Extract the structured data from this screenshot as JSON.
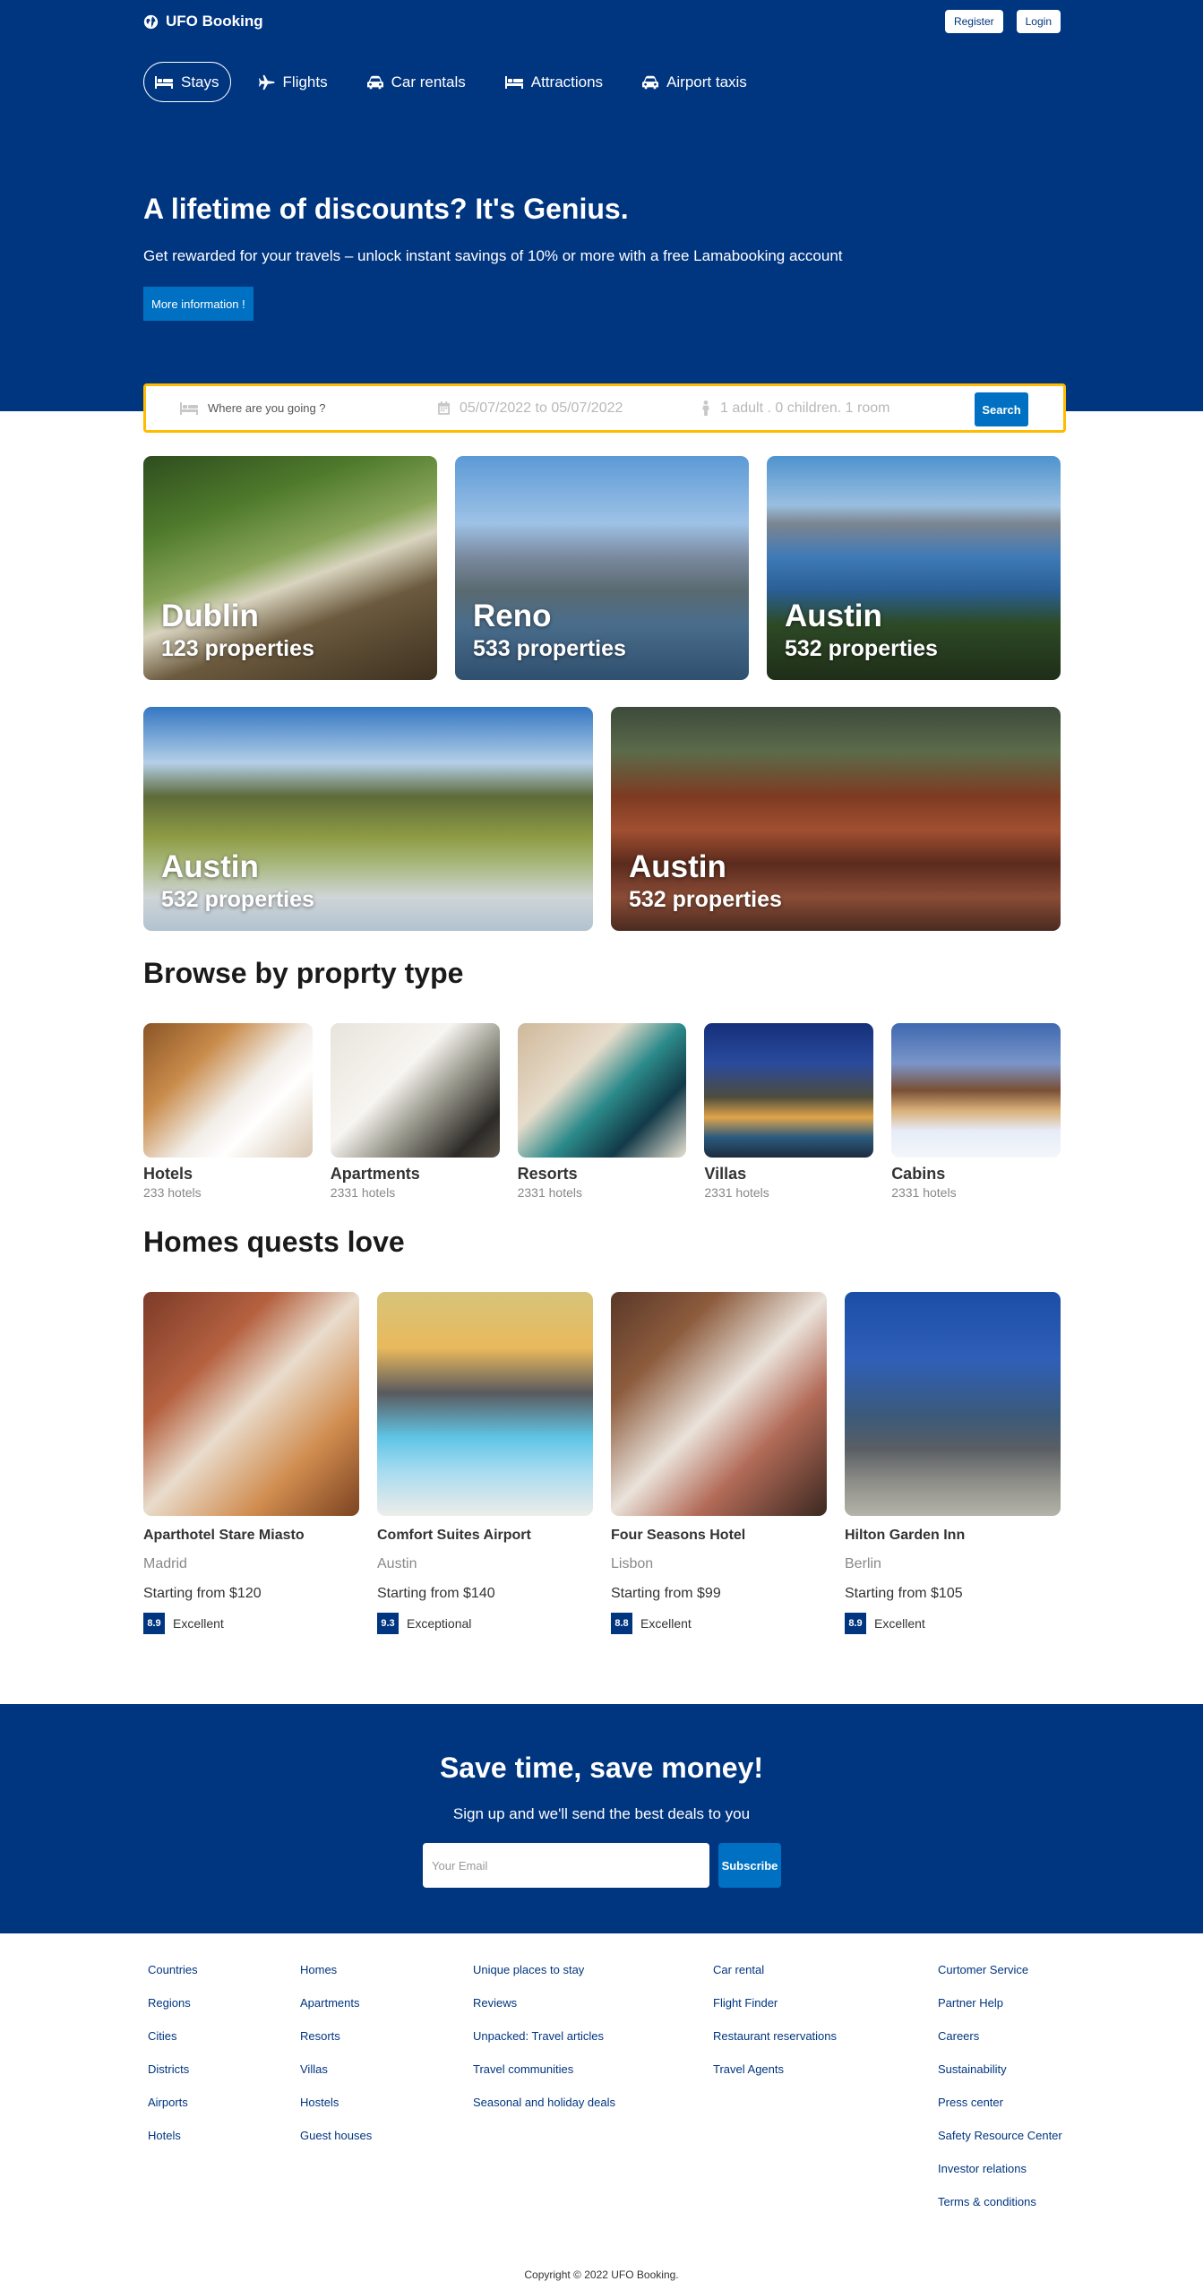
{
  "header": {
    "logo": "UFO Booking",
    "register": "Register",
    "login": "Login",
    "nav": [
      {
        "label": "Stays",
        "icon": "bed-icon",
        "active": true
      },
      {
        "label": "Flights",
        "icon": "plane-icon",
        "active": false
      },
      {
        "label": "Car rentals",
        "icon": "car-icon",
        "active": false
      },
      {
        "label": "Attractions",
        "icon": "bed-icon",
        "active": false
      },
      {
        "label": "Airport taxis",
        "icon": "taxi-icon",
        "active": false
      }
    ],
    "title": "A lifetime of discounts? It's Genius.",
    "desc": "Get rewarded for your travels – unlock instant savings of 10% or more with a free Lamabooking account",
    "cta": "More information !"
  },
  "search": {
    "destination_placeholder": "Where are you going ?",
    "dates": "05/07/2022 to 05/07/2022",
    "guests": "1 adult . 0 children. 1 room",
    "button": "Search"
  },
  "featured": [
    {
      "name": "Dublin",
      "count": "123 properties"
    },
    {
      "name": "Reno",
      "count": "533 properties"
    },
    {
      "name": "Austin",
      "count": "532 properties"
    },
    {
      "name": "Austin",
      "count": "532 properties"
    },
    {
      "name": "Austin",
      "count": "532 properties"
    }
  ],
  "property_types": {
    "title": "Browse by proprty type",
    "items": [
      {
        "name": "Hotels",
        "count": "233 hotels"
      },
      {
        "name": "Apartments",
        "count": "2331 hotels"
      },
      {
        "name": "Resorts",
        "count": "2331 hotels"
      },
      {
        "name": "Villas",
        "count": "2331 hotels"
      },
      {
        "name": "Cabins",
        "count": "2331 hotels"
      }
    ]
  },
  "homes": {
    "title": "Homes quests love",
    "items": [
      {
        "name": "Aparthotel Stare Miasto",
        "city": "Madrid",
        "price": "Starting from $120",
        "score": "8.9",
        "rating": "Excellent"
      },
      {
        "name": "Comfort Suites Airport",
        "city": "Austin",
        "price": "Starting from $140",
        "score": "9.3",
        "rating": "Exceptional"
      },
      {
        "name": "Four Seasons Hotel",
        "city": "Lisbon",
        "price": "Starting from $99",
        "score": "8.8",
        "rating": "Excellent"
      },
      {
        "name": "Hilton Garden Inn",
        "city": "Berlin",
        "price": "Starting from $105",
        "score": "8.9",
        "rating": "Excellent"
      }
    ]
  },
  "newsletter": {
    "title": "Save time, save money!",
    "desc": "Sign up and we'll send the best deals to you",
    "placeholder": "Your Email",
    "button": "Subscribe"
  },
  "footer": {
    "col1": [
      "Countries",
      "Regions",
      "Cities",
      "Districts",
      "Airports",
      "Hotels"
    ],
    "col2": [
      "Homes",
      "Apartments",
      "Resorts",
      "Villas",
      "Hostels",
      "Guest houses"
    ],
    "col3": [
      "Unique places to stay",
      "Reviews",
      "Unpacked: Travel articles",
      "Travel communities",
      "Seasonal and holiday deals"
    ],
    "col4": [
      "Car rental",
      "Flight Finder",
      "Restaurant reservations",
      "Travel Agents"
    ],
    "col5": [
      "Curtomer Service",
      "Partner Help",
      "Careers",
      "Sustainability",
      "Press center",
      "Safety Resource Center",
      "Investor relations",
      "Terms & conditions"
    ],
    "copyright": "Copyright © 2022 UFO Booking."
  },
  "colors": {
    "primary": "#003580",
    "accent": "#0071c2",
    "search_border": "#febb02"
  }
}
